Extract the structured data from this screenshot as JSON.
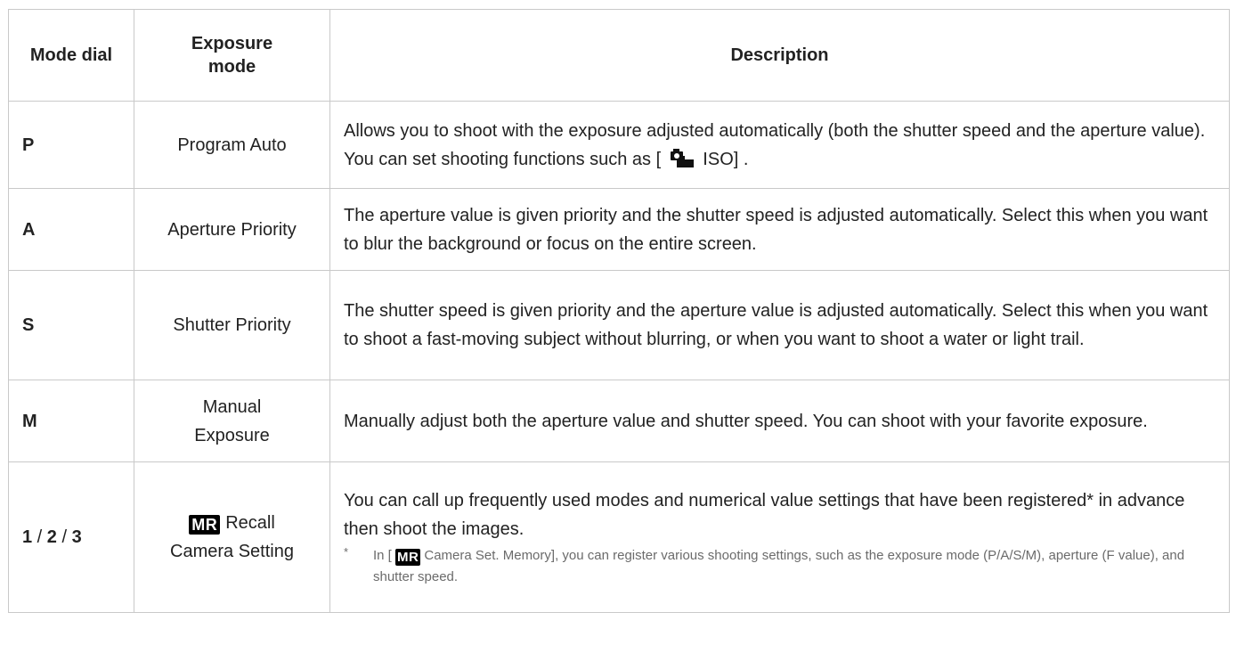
{
  "table": {
    "headers": {
      "dial": "Mode dial",
      "mode_line1": "Exposure",
      "mode_line2": "mode",
      "description": "Description"
    },
    "rows": [
      {
        "dial": "P",
        "mode": "Program Auto",
        "desc_before": "Allows you to shoot with the exposure adjusted automatically (both the shutter speed and the aperture value). You can set shooting functions such as [",
        "desc_icon": "camera-iso-icon",
        "desc_after": "ISO] ."
      },
      {
        "dial": "A",
        "mode": "Aperture Priority",
        "desc": "The aperture value is given priority and the shutter speed is adjusted automatically. Select this when you want to blur the background or focus on the entire screen."
      },
      {
        "dial": "S",
        "mode": "Shutter Priority",
        "desc": "The shutter speed is given priority and the aperture value is adjusted automatically. Select this when you want to shoot a fast-moving subject without blurring, or when you want to shoot a water or light trail."
      },
      {
        "dial": "M",
        "mode_line1": "Manual",
        "mode_line2": "Exposure",
        "desc": "Manually adjust both the aperture value and shutter speed. You can shoot with your favorite exposure."
      },
      {
        "dial_1": "1",
        "dial_sep1": " / ",
        "dial_2": "2",
        "dial_sep2": " / ",
        "dial_3": "3",
        "mode_icon": "MR",
        "mode_line1": "Recall",
        "mode_line2": "Camera Setting",
        "desc": "You can call up frequently used modes and numerical value settings that have been registered* in advance then shoot the images.",
        "note_mark": "*",
        "note_before": "In [",
        "note_icon": "MR",
        "note_after": "Camera Set. Memory], you can register various shooting settings, such as the exposure mode (P/A/S/M), aperture (F value), and shutter speed."
      }
    ]
  }
}
